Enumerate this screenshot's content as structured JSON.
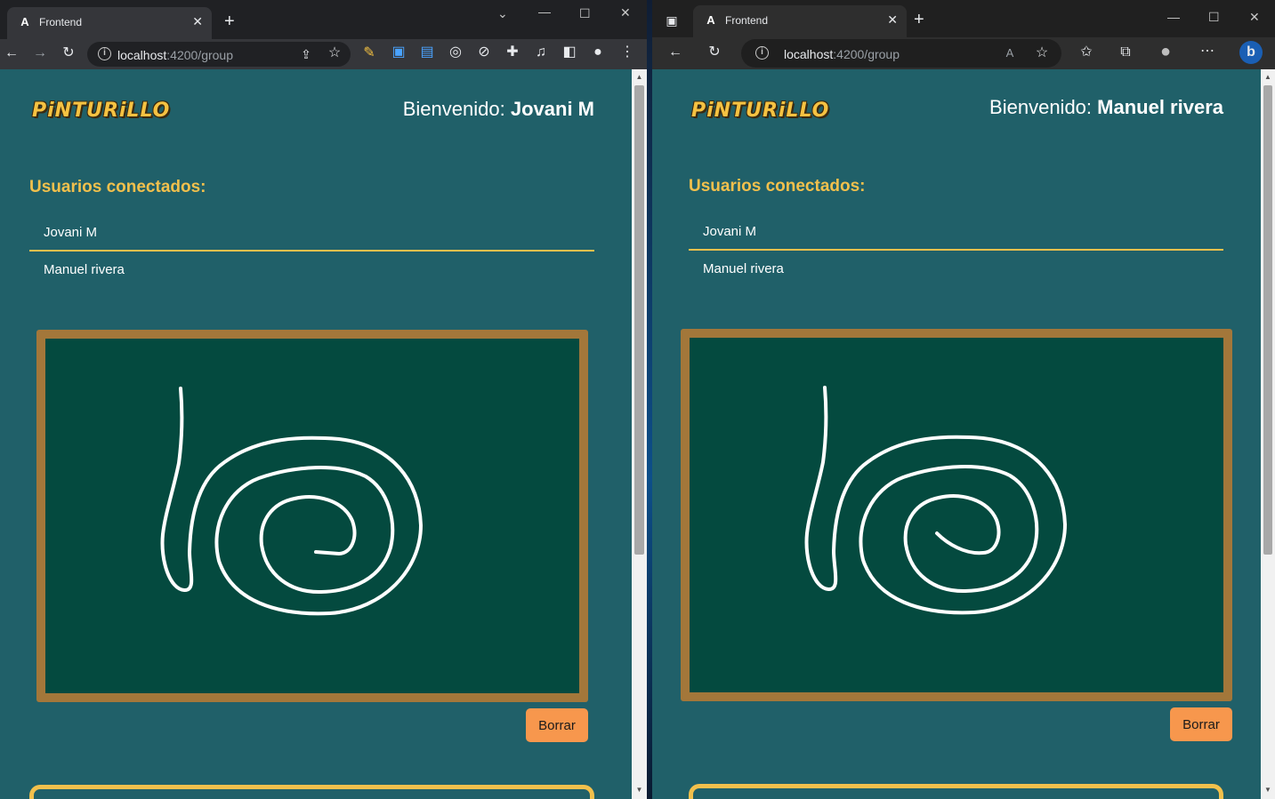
{
  "chrome_window": {
    "tab_title": "Frontend",
    "url_host": "localhost",
    "url_rest": ":4200/group",
    "page": {
      "logo": "PiNTURiLLO",
      "welcome_prefix": "Bienvenido:",
      "welcome_user": "Jovani M",
      "users_title": "Usuarios conectados:",
      "users": [
        "Jovani M",
        "Manuel rivera"
      ],
      "clear_button": "Borrar"
    }
  },
  "edge_window": {
    "tab_title": "Frontend",
    "url_host": "localhost",
    "url_rest": ":4200/group",
    "page": {
      "logo": "PiNTURiLLO",
      "welcome_prefix": "Bienvenido:",
      "welcome_user": "Manuel rivera",
      "users_title": "Usuarios conectados:",
      "users": [
        "Jovani M",
        "Manuel rivera"
      ],
      "clear_button": "Borrar"
    }
  },
  "colors": {
    "page_bg": "#206069",
    "accent_yellow": "#f2c04c",
    "board_frame": "#a3773a",
    "board_surface": "#044a3f",
    "stroke": "#ffffff",
    "button": "#f7974d"
  },
  "icons": {
    "chrome_toolbar": [
      "back-icon",
      "forward-icon",
      "reload-icon",
      "info-icon",
      "share-icon",
      "star-icon",
      "extension-icons",
      "puzzle-icon",
      "media-icon",
      "sidepanel-icon",
      "profile-avatar",
      "menu-icon"
    ],
    "edge_toolbar": [
      "back-icon",
      "reload-icon",
      "info-icon",
      "read-aloud-icon",
      "add-favorite-icon",
      "favorites-icon",
      "collections-icon",
      "profile-icon",
      "more-icon",
      "bing-icon"
    ]
  }
}
